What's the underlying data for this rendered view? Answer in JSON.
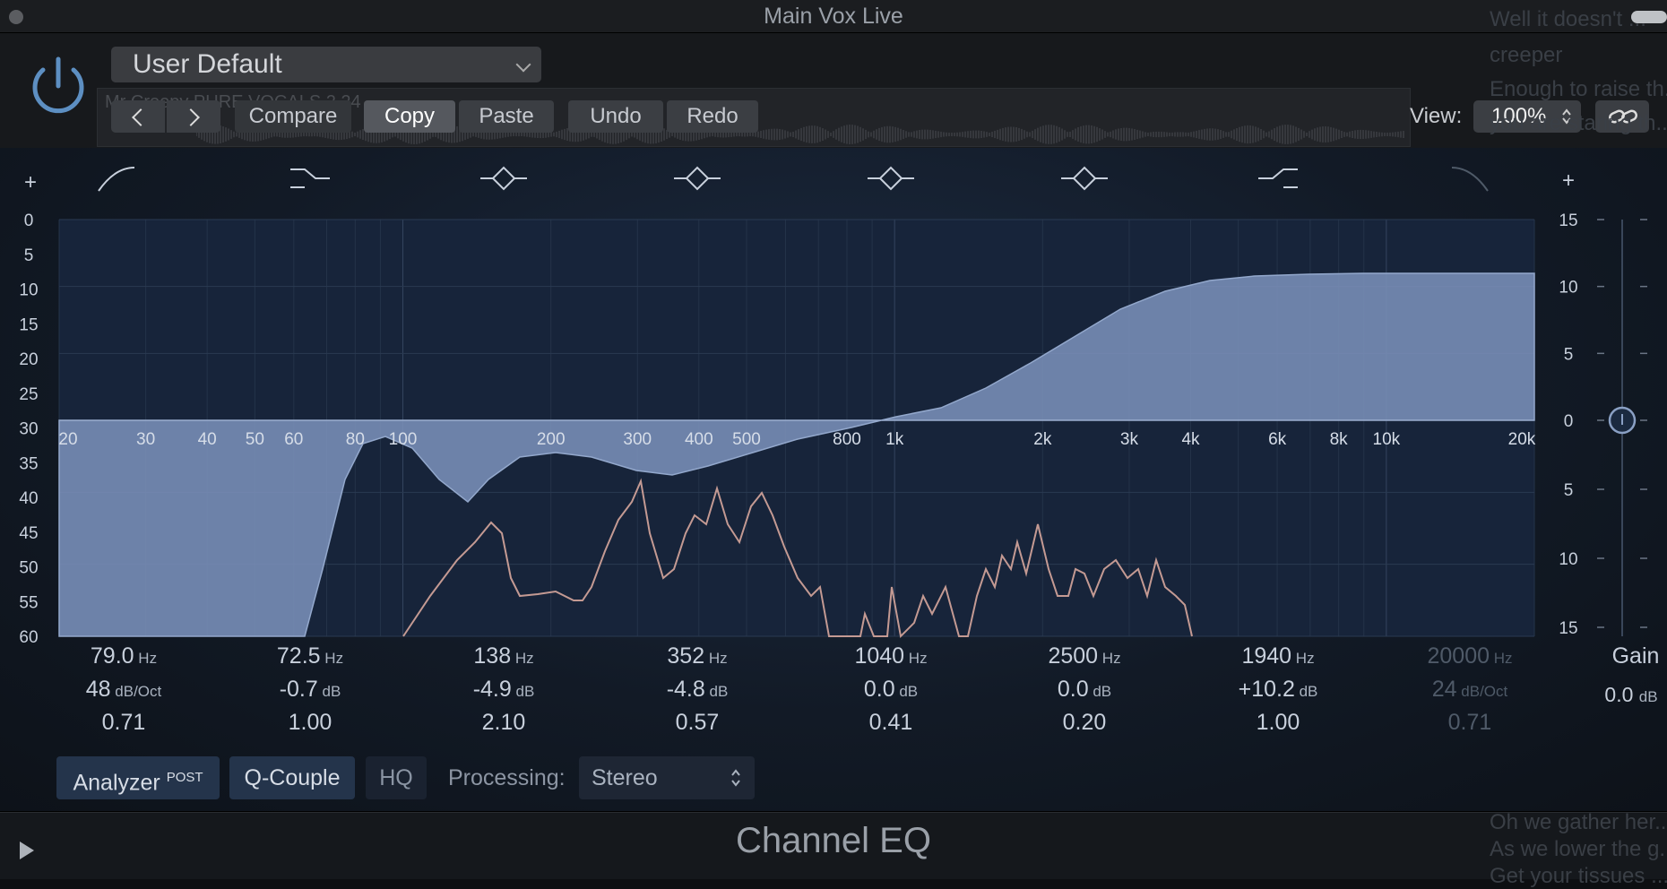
{
  "window": {
    "title": "Main Vox Live"
  },
  "header": {
    "preset": "User Default",
    "track_name": "Mr Creepy PURE VOCALS 2.24",
    "buttons": {
      "compare": "Compare",
      "copy": "Copy",
      "paste": "Paste",
      "undo": "Undo",
      "redo": "Redo"
    },
    "view_label": "View:",
    "view_value": "100%"
  },
  "lyrics": [
    "Well it doesn't ...",
    "creeper",
    "Enough to raise th...",
    "you are staring th...",
    "Oh we gather her...",
    "As we lower the g...",
    "Get your tissues ..."
  ],
  "eq": {
    "left_db_scale": [
      "0",
      "5",
      "10",
      "15",
      "20",
      "25",
      "30",
      "35",
      "40",
      "45",
      "50",
      "55",
      "60"
    ],
    "right_db_scale": [
      "15",
      "10",
      "5",
      "0",
      "5",
      "10",
      "15"
    ],
    "freq_labels": [
      "20",
      "30",
      "40",
      "50",
      "60",
      "80",
      "100",
      "200",
      "300",
      "400",
      "500",
      "800",
      "1k",
      "2k",
      "3k",
      "4k",
      "6k",
      "8k",
      "10k",
      "20k"
    ],
    "plus_symbol": "+",
    "band_icons": [
      "low-cut-icon",
      "low-shelf-icon",
      "bell-icon",
      "bell-icon",
      "bell-icon",
      "bell-icon",
      "high-shelf-icon",
      "high-cut-icon"
    ],
    "bands": [
      {
        "freq": "79.0",
        "freq_unit": "Hz",
        "gain": "48",
        "gain_unit": "dB/Oct",
        "q": "0.71",
        "enabled": true
      },
      {
        "freq": "72.5",
        "freq_unit": "Hz",
        "gain": "-0.7",
        "gain_unit": "dB",
        "q": "1.00",
        "enabled": true
      },
      {
        "freq": "138",
        "freq_unit": "Hz",
        "gain": "-4.9",
        "gain_unit": "dB",
        "q": "2.10",
        "enabled": true
      },
      {
        "freq": "352",
        "freq_unit": "Hz",
        "gain": "-4.8",
        "gain_unit": "dB",
        "q": "0.57",
        "enabled": true
      },
      {
        "freq": "1040",
        "freq_unit": "Hz",
        "gain": "0.0",
        "gain_unit": "dB",
        "q": "0.41",
        "enabled": true
      },
      {
        "freq": "2500",
        "freq_unit": "Hz",
        "gain": "0.0",
        "gain_unit": "dB",
        "q": "0.20",
        "enabled": true
      },
      {
        "freq": "1940",
        "freq_unit": "Hz",
        "gain": "+10.2",
        "gain_unit": "dB",
        "q": "1.00",
        "enabled": true
      },
      {
        "freq": "20000",
        "freq_unit": "Hz",
        "gain": "24",
        "gain_unit": "dB/Oct",
        "q": "0.71",
        "enabled": false
      }
    ],
    "gain_label": "Gain",
    "gain_value": "0.0",
    "gain_unit": "dB"
  },
  "footer_controls": {
    "analyzer": "Analyzer",
    "analyzer_mode": "POST",
    "q_couple": "Q-Couple",
    "hq": "HQ",
    "processing_label": "Processing:",
    "processing_value": "Stereo"
  },
  "footer": {
    "plugin_name": "Channel EQ"
  },
  "colors": {
    "curve_fill": "#7a90b8",
    "analyzer_line": "#c49a93",
    "grid": "#2a3850"
  }
}
